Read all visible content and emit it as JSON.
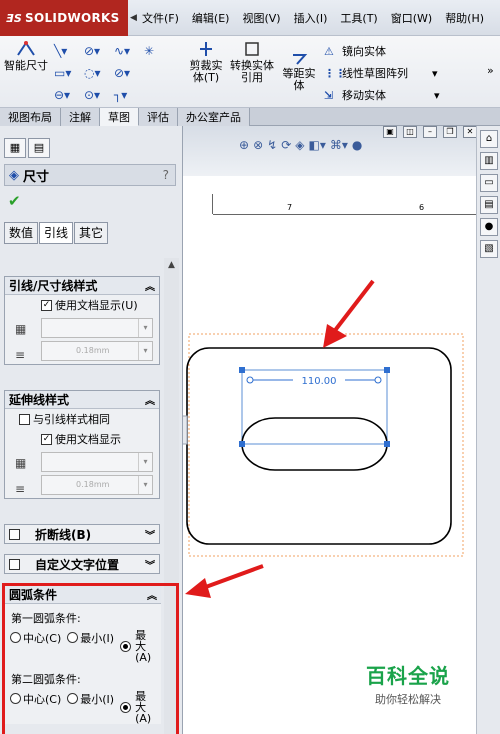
{
  "app": {
    "logo": "SOLIDWORKS",
    "menus": [
      "文件(F)",
      "编辑(E)",
      "视图(V)",
      "插入(I)",
      "工具(T)",
      "窗口(W)",
      "帮助(H)"
    ]
  },
  "command_manager": {
    "smart_dimension": "智能尺寸",
    "trim": "剪裁实体(T)",
    "convert": "转换实体引用",
    "offset": "等距实体",
    "mirror": "镜向实体",
    "linear_pattern": "线性草图阵列",
    "move": "移动实体"
  },
  "tabs": [
    "视图布局",
    "注解",
    "草图",
    "评估",
    "办公室产品"
  ],
  "active_tab": "草图",
  "panel": {
    "title": "尺寸",
    "help": "?",
    "subtabs": [
      "数值",
      "引线",
      "其它"
    ],
    "active_subtab": "引线",
    "leader_style": {
      "header": "引线/尺寸线样式",
      "use_doc": "使用文档显示(U)",
      "thickness": "0.18mm"
    },
    "extension_style": {
      "header": "延伸线样式",
      "same_as_leader": "与引线样式相同",
      "use_doc": "使用文档显示",
      "thickness": "0.18mm"
    },
    "broken_leader": "折断线(B)",
    "custom_text_pos": "自定义文字位置",
    "arc_condition": {
      "header": "圆弧条件",
      "first": "第一圆弧条件:",
      "second": "第二圆弧条件:",
      "center": "中心(C)",
      "min": "最小(I)",
      "max_line1": "最",
      "max_line2": "大",
      "max_line3": "(A)"
    }
  },
  "graphics": {
    "dimension_value": "110.00",
    "ruler_labels": [
      "7",
      "6"
    ]
  },
  "watermark": {
    "title": "百科全说",
    "subtitle": "助你轻松解决"
  },
  "colors": {
    "logo_red": "#b1261f",
    "highlight_red": "#e01b1b",
    "dimension_blue": "#2f6fd0",
    "watermark_green": "#1aa34a"
  }
}
